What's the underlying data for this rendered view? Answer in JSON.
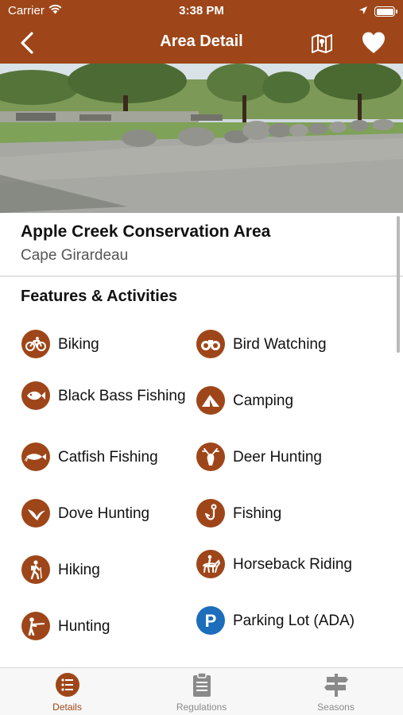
{
  "status_bar": {
    "carrier": "Carrier",
    "time": "3:38 PM"
  },
  "nav": {
    "title": "Area Detail",
    "icons": [
      "back-chevron-icon",
      "map-icon",
      "heart-icon"
    ]
  },
  "area": {
    "name": "Apple Creek Conservation Area",
    "county": "Cape Girardeau"
  },
  "features": {
    "title": "Features & Activities",
    "items": [
      {
        "label": "Biking",
        "icon": "bike-icon"
      },
      {
        "label": "Bird Watching",
        "icon": "binoculars-icon"
      },
      {
        "label": "Black Bass Fishing",
        "icon": "bass-fish-icon"
      },
      {
        "label": "Camping",
        "icon": "tent-icon"
      },
      {
        "label": "Catfish Fishing",
        "icon": "catfish-icon"
      },
      {
        "label": "Deer Hunting",
        "icon": "deer-icon"
      },
      {
        "label": "Dove Hunting",
        "icon": "dove-icon"
      },
      {
        "label": "Fishing",
        "icon": "fish-hook-icon"
      },
      {
        "label": "Hiking",
        "icon": "hiker-icon"
      },
      {
        "label": "Horseback Riding",
        "icon": "horse-rider-icon"
      },
      {
        "label": "Hunting",
        "icon": "hunter-icon"
      },
      {
        "label": "Parking Lot (ADA)",
        "icon": "parking-icon"
      }
    ]
  },
  "tabs": [
    {
      "label": "Details",
      "icon": "list-icon",
      "active": true
    },
    {
      "label": "Regulations",
      "icon": "clipboard-icon",
      "active": false
    },
    {
      "label": "Seasons",
      "icon": "signpost-icon",
      "active": false
    }
  ],
  "colors": {
    "brand": "#9e4619",
    "parking": "#1c6dbb",
    "tab_inactive": "#8a8a8a"
  }
}
